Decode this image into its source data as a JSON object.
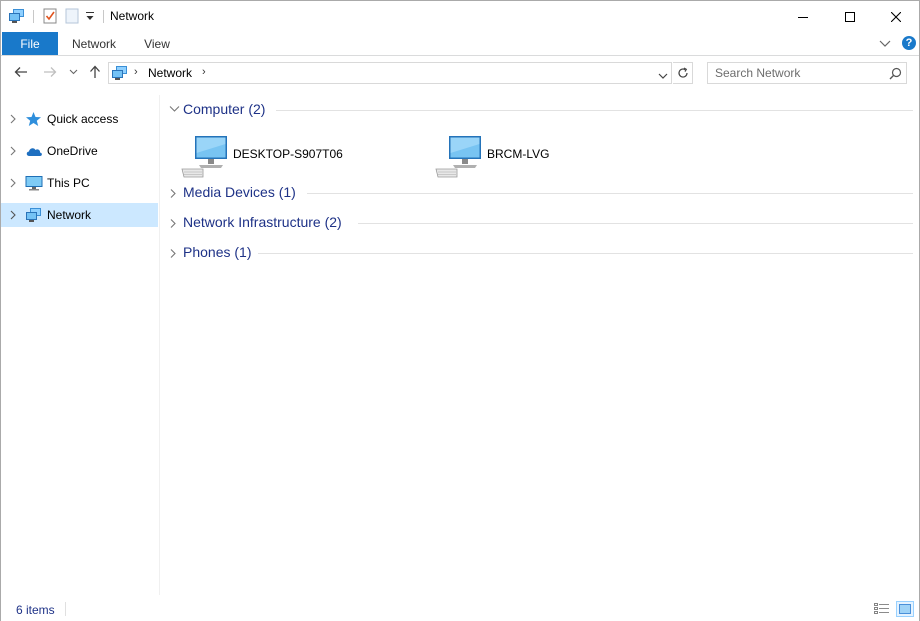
{
  "window": {
    "title": "Network"
  },
  "ribbon": {
    "tabs": [
      {
        "label": "File"
      },
      {
        "label": "Network"
      },
      {
        "label": "View"
      }
    ],
    "help_glyph": "?"
  },
  "address": {
    "path": "Network",
    "separator": "›"
  },
  "search": {
    "placeholder": "Search Network",
    "value": ""
  },
  "sidebar": {
    "items": [
      {
        "label": "Quick access",
        "icon": "star-icon"
      },
      {
        "label": "OneDrive",
        "icon": "cloud-icon"
      },
      {
        "label": "This PC",
        "icon": "computer-icon"
      },
      {
        "label": "Network",
        "icon": "network-icon",
        "selected": true
      }
    ]
  },
  "groups": [
    {
      "title": "Computer (2)",
      "expanded": true,
      "items": [
        {
          "label": "DESKTOP-S907T06",
          "icon": "desktop-computer-icon"
        },
        {
          "label": "BRCM-LVG",
          "icon": "desktop-computer-icon"
        }
      ]
    },
    {
      "title": "Media Devices (1)",
      "expanded": false
    },
    {
      "title": "Network Infrastructure (2)",
      "expanded": false
    },
    {
      "title": "Phones (1)",
      "expanded": false
    }
  ],
  "status": {
    "item_count": "6 items",
    "active_view": "large-icons"
  },
  "colors": {
    "accent": "#1979ca",
    "selection": "#cce8ff",
    "group_text": "#1e3287"
  }
}
